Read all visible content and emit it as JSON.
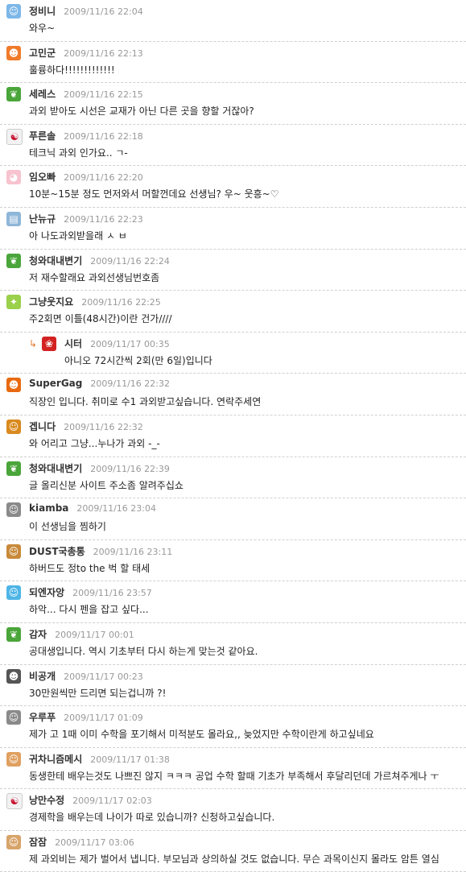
{
  "comments": [
    {
      "name": "정비니",
      "time": "2009/11/16 22:04",
      "text": "와우~",
      "avatar": "smiley-face-icon",
      "avatar_color": "#7db7e8",
      "avatar_glyph": "☺"
    },
    {
      "name": "고민군",
      "time": "2009/11/16 22:13",
      "text": "훌륭하다!!!!!!!!!!!!!",
      "avatar": "cartoon-avatar-icon",
      "avatar_color": "#f07b2a",
      "avatar_glyph": "☻"
    },
    {
      "name": "세레스",
      "time": "2009/11/16 22:15",
      "text": "과외 받아도 시선은 교재가 아닌 다른 곳을 향할 거잖아?",
      "avatar": "leaf-icon",
      "avatar_color": "#4aa53a",
      "avatar_glyph": "❦"
    },
    {
      "name": "푸른솔",
      "time": "2009/11/16 22:18",
      "text": "테크닉 과외 인가요.. ㄱ-",
      "avatar": "korea-flag-icon",
      "avatar_color": "#f2f2f2",
      "avatar_glyph": "☯"
    },
    {
      "name": "임오빠",
      "time": "2009/11/16 22:20",
      "text": "10분~15분 정도 먼저와서 머할껀데요 선생님? 우~ 웃흥~♡",
      "avatar": "pig-face-icon",
      "avatar_color": "#f7c3cf",
      "avatar_glyph": "◕"
    },
    {
      "name": "난뉴규",
      "time": "2009/11/16 22:23",
      "text": "아 나도과외받을래 ㅅ ㅂ",
      "avatar": "notebook-icon",
      "avatar_color": "#8fb6d8",
      "avatar_glyph": "▤"
    },
    {
      "name": "청와대내변기",
      "time": "2009/11/16 22:24",
      "text": "저 재수할래요 과외선생님번호좀",
      "avatar": "leaf-icon",
      "avatar_color": "#4aa53a",
      "avatar_glyph": "❦"
    },
    {
      "name": "그냥웃지요",
      "time": "2009/11/16 22:25",
      "text": "주2회면 이틀(48시간)이란 건가////",
      "avatar": "sparkle-icon",
      "avatar_color": "#9ad04a",
      "avatar_glyph": "✦"
    },
    {
      "name": "시터",
      "time": "2009/11/17 00:35",
      "text": "아니오 72시간씩 2회(만 6일)입니다",
      "avatar": "red-bow-icon",
      "avatar_color": "#d32222",
      "avatar_glyph": "❀",
      "reply": true
    },
    {
      "name": "SuperGag",
      "time": "2009/11/16 22:32",
      "text": "직장인 입니다. 취미로 수1 과외받고싶습니다. 연락주세연",
      "avatar": "pumpkin-icon",
      "avatar_color": "#e86a10",
      "avatar_glyph": "☻"
    },
    {
      "name": "겝니다",
      "time": "2009/11/16 22:32",
      "text": "와 어리고 그냥...누나가 과외 -_-",
      "avatar": "lion-face-icon",
      "avatar_color": "#d98a1e",
      "avatar_glyph": "☺"
    },
    {
      "name": "청와대내변기",
      "time": "2009/11/16 22:39",
      "text": "글 올리신분 사이트 주소좀 알려주십쇼",
      "avatar": "leaf-icon",
      "avatar_color": "#4aa53a",
      "avatar_glyph": "❦"
    },
    {
      "name": "kiamba",
      "time": "2009/11/16 23:04",
      "text": "이 선생님을 찜하기",
      "avatar": "glasses-face-icon",
      "avatar_color": "#8a8a8a",
      "avatar_glyph": "☺"
    },
    {
      "name": "DUST국총통",
      "time": "2009/11/16 23:11",
      "text": "하버드도 정to the 벅 할 태세",
      "avatar": "monkey-icon",
      "avatar_color": "#c88a3a",
      "avatar_glyph": "☺"
    },
    {
      "name": "되엔자앙",
      "time": "2009/11/16 23:57",
      "text": "하악... 다시 펜을 잡고 싶다...",
      "avatar": "blue-bear-icon",
      "avatar_color": "#4fb5e6",
      "avatar_glyph": "☺"
    },
    {
      "name": "감자",
      "time": "2009/11/17 00:01",
      "text": "공대생입니다. 역시 기초부터 다시 하는게 맞는것 같아요.",
      "avatar": "leaf-icon",
      "avatar_color": "#4aa53a",
      "avatar_glyph": "❦"
    },
    {
      "name": "비공개",
      "time": "2009/11/17 00:23",
      "text": "30만원씩만 드리면 되는겁니까 ?!",
      "avatar": "masked-face-icon",
      "avatar_color": "#555555",
      "avatar_glyph": "☻"
    },
    {
      "name": "우루푸",
      "time": "2009/11/17 01:09",
      "text": "제가 고 1때 이미 수학을 포기해서 미적분도 몰라요,, 늦었지만 수학이란게 하고싶네요",
      "avatar": "glasses-face-icon",
      "avatar_color": "#8a8a8a",
      "avatar_glyph": "☺"
    },
    {
      "name": "귀차니즘메시",
      "time": "2009/11/17 01:38",
      "text": "동생한테 배우는것도 나쁘진 않지 ㅋㅋㅋ 공업 수학 할때 기초가 부족해서 후달리던데 가르쳐주게나 ㅜ",
      "avatar": "boy-face-icon",
      "avatar_color": "#e0a060",
      "avatar_glyph": "☺"
    },
    {
      "name": "낭만수정",
      "time": "2009/11/17 02:03",
      "text": "경제학을 배우는데 나이가 따로 있습니까? 신청하고싶습니다.",
      "avatar": "korea-flag-icon",
      "avatar_color": "#f2f2f2",
      "avatar_glyph": "☯"
    },
    {
      "name": "잠잠",
      "time": "2009/11/17 03:06",
      "text": "제 과외비는 제가 벌어서 냅니다. 부모님과 상의하실 것도 없습니다. 무슨 과목이신지 몰라도 암튼 열심",
      "avatar": "glasses-face-icon",
      "avatar_color": "#d7a46a",
      "avatar_glyph": "☺"
    }
  ],
  "reply_arrow": "↳"
}
